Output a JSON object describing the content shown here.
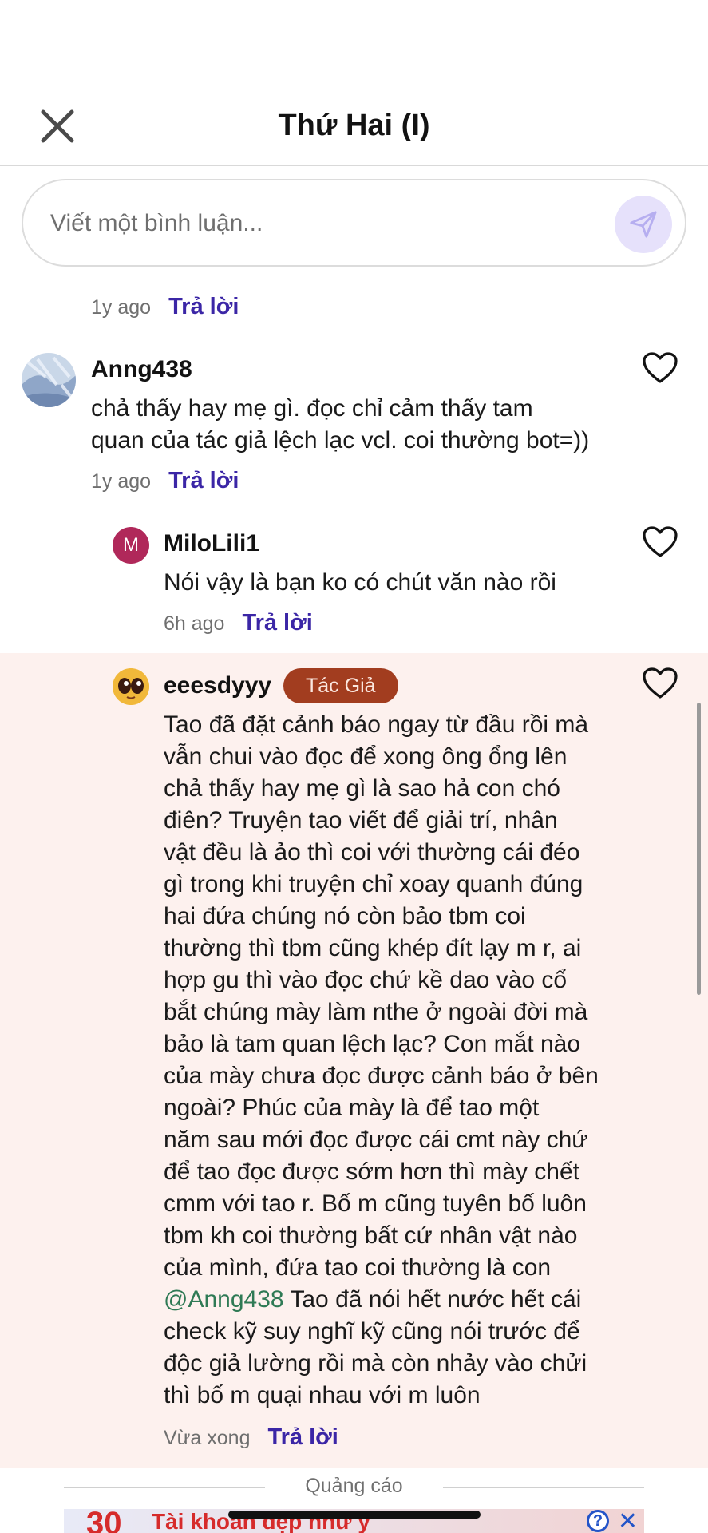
{
  "header": {
    "title": "Thứ Hai (I)",
    "close_icon": "close-icon"
  },
  "composer": {
    "placeholder": "Viết một bình luận...",
    "send_icon": "send-icon",
    "send_color": "#e6e1fb"
  },
  "prev_comment": {
    "time": "1y ago",
    "reply": "Trả lời"
  },
  "comments": [
    {
      "username": "Anng438",
      "lines": [
        "chả thấy hay mẹ gì. đọc chỉ cảm thấy tam",
        "quan của tác giả lệch lạc vcl. coi thường bot=))"
      ],
      "time": "1y ago",
      "reply": "Trả lời",
      "avatar": "landscape-avatar"
    },
    {
      "username": "MiloLili1",
      "avatar_letter": "M",
      "avatar_color": "#b0285a",
      "lines": [
        "Nói vậy là bạn ko có chút văn nào rồi"
      ],
      "time": "6h ago",
      "reply": "Trả lời"
    },
    {
      "username": "eeesdyyy",
      "badge": "Tác Giả",
      "badge_color": "#a23d1f",
      "avatar": "cartoon-avatar",
      "lines": [
        "Tao đã đặt cảnh báo ngay từ đầu rồi mà",
        "vẫn chui vào đọc để xong ông ổng lên",
        "chả thấy hay mẹ gì là sao hả con chó",
        "điên? Truyện tao viết để giải trí, nhân",
        "vật đều là ảo thì coi với thường cái đéo",
        "gì trong khi truyện chỉ xoay quanh đúng",
        "hai đứa chúng nó còn bảo tbm coi",
        "thường thì tbm cũng khép đít lạy m r, ai",
        "hợp gu thì vào đọc chứ kề dao vào cổ",
        "bắt chúng mày làm nthe ở ngoài đời mà",
        "bảo là tam quan lệch lạc? Con mắt nào",
        "của mày chưa đọc được cảnh báo ở bên",
        "ngoài? Phúc của mày là để tao một",
        "năm sau mới đọc được cái cmt này chứ",
        "để tao đọc được sớm hơn thì mày chết",
        "cmm với tao r. Bố m cũng tuyên bố luôn",
        "tbm kh coi thường bất cứ nhân vật nào",
        "của mình, đứa tao coi thường là con"
      ],
      "mention": "@Anng438",
      "mention_rest": " Tao đã nói hết nước hết cái",
      "lines_after": [
        "check kỹ suy nghĩ kỹ cũng nói trước để",
        "độc giả lường rồi mà còn nhảy vào chửi",
        "thì bố m quại nhau với m luôn"
      ],
      "time": "Vừa xong",
      "reply": "Trả lời",
      "highlight_bg": "#fdf1ee"
    }
  ],
  "ad": {
    "label": "Quảng cáo",
    "banner_number": "30",
    "banner_text": "Tài khoản đẹp như ý",
    "info_symbol": "?",
    "close_symbol": "✕"
  },
  "accent_color": "#3b26a6"
}
